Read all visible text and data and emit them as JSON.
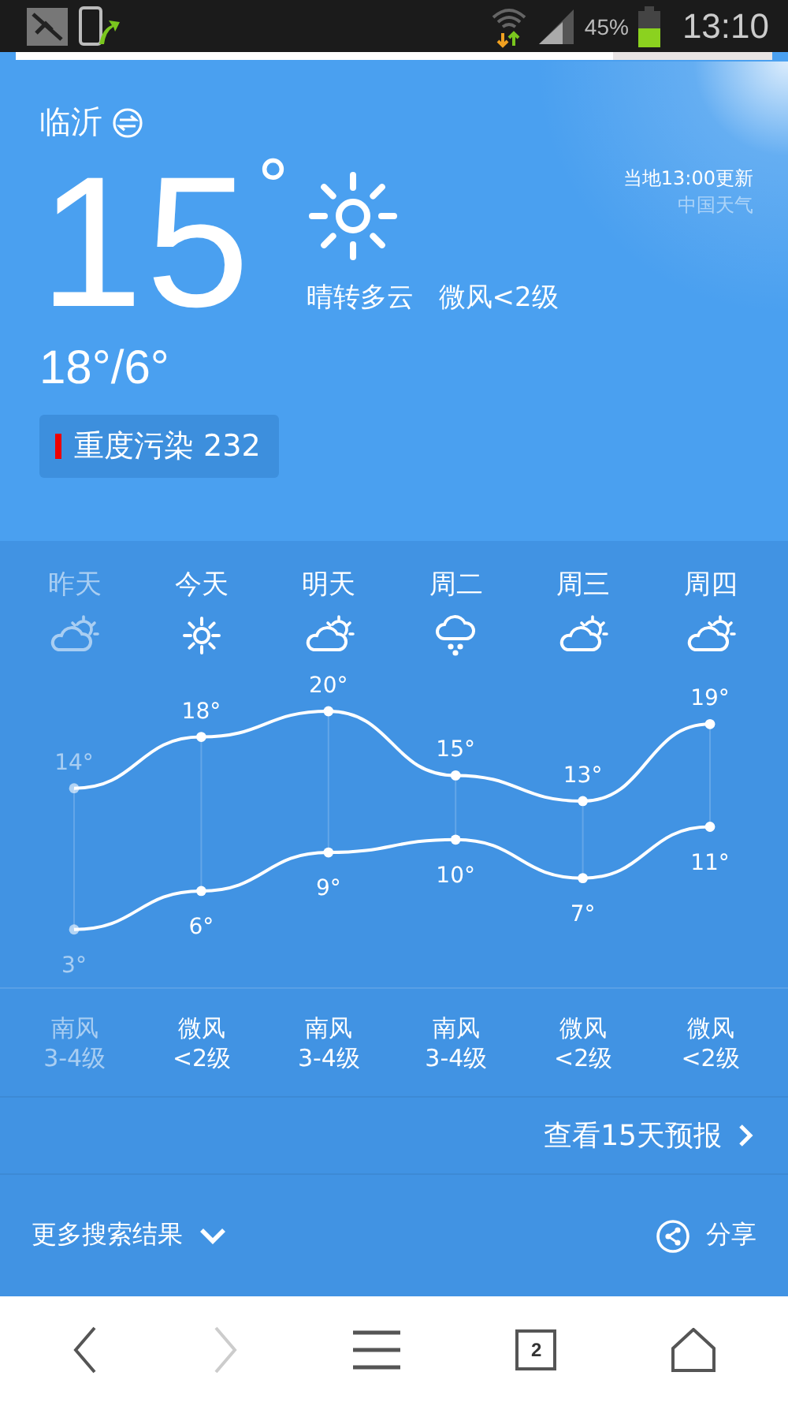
{
  "status_bar": {
    "battery": "45%",
    "time": "13:10"
  },
  "page_load": {
    "level": 0.79
  },
  "city": {
    "name": "临沂"
  },
  "current": {
    "temperature": "15",
    "degree": "°",
    "condition": "晴转多云",
    "wind": "微风<2级",
    "range": "18°/6°",
    "update": "当地13:00更新",
    "source": "中国天气",
    "air": {
      "label": "重度污染 232"
    }
  },
  "forecast": {
    "days": [
      {
        "kind": "partly_cloudy",
        "past": true,
        "wind": "南风",
        "wind_level": "3-4级"
      },
      {
        "kind": "sunny",
        "past": false,
        "wind": "微风",
        "wind_level": "<2级"
      },
      {
        "kind": "partly_cloudy",
        "past": false,
        "wind": "南风",
        "wind_level": "3-4级"
      },
      {
        "kind": "rain",
        "past": false,
        "wind": "南风",
        "wind_level": "3-4级"
      },
      {
        "kind": "partly_cloudy",
        "past": false,
        "wind": "微风",
        "wind_level": "<2级"
      },
      {
        "kind": "partly_cloudy",
        "past": false,
        "wind": "微风",
        "wind_level": "<2级"
      }
    ],
    "chart_data": {
      "type": "line",
      "categories": [
        "昨天",
        "今天",
        "明天",
        "周二",
        "周三",
        "周四"
      ],
      "series": [
        {
          "color": "#ffffff",
          "marker": "circle",
          "values": [
            14,
            18,
            20,
            15,
            13,
            19
          ],
          "value_labels": [
            "14°",
            "18°",
            "20°",
            "15°",
            "13°",
            "19°"
          ]
        },
        {
          "color": "#ffffff",
          "marker": "circle",
          "values": [
            3,
            6,
            9,
            10,
            7,
            11
          ],
          "value_labels": [
            "3°",
            "6°",
            "9°",
            "10°",
            "7°",
            "11°"
          ]
        }
      ]
    }
  },
  "more_link": "查看15天预报",
  "footer": {
    "more": "更多搜索结果",
    "share": "分享"
  },
  "browser_nav": {
    "tabs": "2"
  }
}
